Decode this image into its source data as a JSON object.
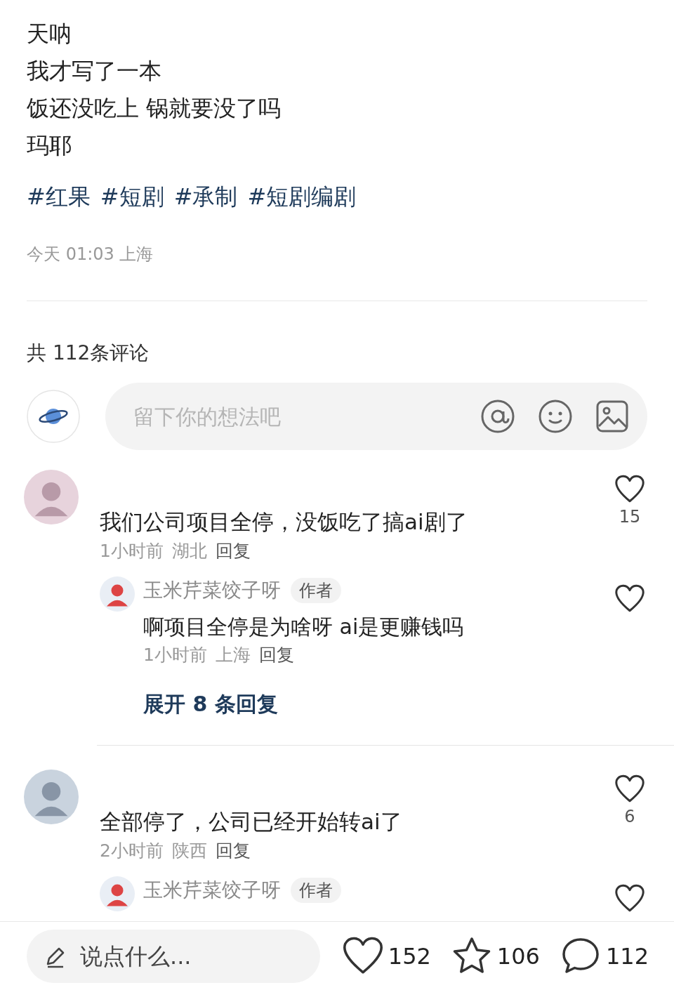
{
  "post": {
    "lines": [
      "天呐",
      "我才写了一本",
      "饭还没吃上 锅就要没了吗",
      "玛耶"
    ],
    "tags": [
      "#红果",
      "#短剧",
      "#承制",
      "#短剧编剧"
    ],
    "meta": "今天 01:03 上海"
  },
  "comments_header": "共 112条评论",
  "comment_input": {
    "placeholder": "留下你的想法吧"
  },
  "comments": [
    {
      "text": "我们公司项目全停，没饭吃了搞ai剧了",
      "time": "1小时前",
      "location": "湖北",
      "reply_label": "回复",
      "likes": "15",
      "replies": [
        {
          "author": "玉米芹菜饺子呀",
          "badge": "作者",
          "text": "啊项目全停是为啥呀 ai是更赚钱吗",
          "time": "1小时前",
          "location": "上海",
          "reply_label": "回复"
        }
      ],
      "expand_label": "展开 8 条回复"
    },
    {
      "text": "全部停了，公司已经开始转ai了",
      "time": "2小时前",
      "location": "陕西",
      "reply_label": "回复",
      "likes": "6",
      "replies": [
        {
          "author": "玉米芹菜饺子呀",
          "badge": "作者"
        }
      ]
    }
  ],
  "bottom_bar": {
    "placeholder": "说点什么...",
    "likes": "152",
    "stars": "106",
    "comments": "112"
  }
}
